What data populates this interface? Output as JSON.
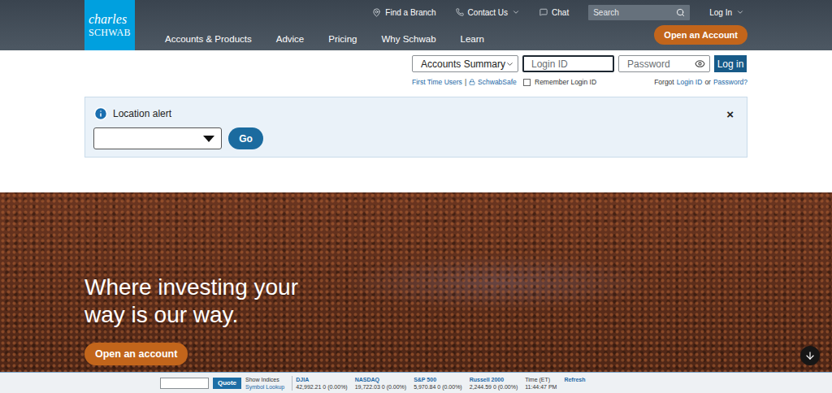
{
  "header": {
    "logo": {
      "line1": "charles",
      "line2": "SCHWAB"
    },
    "find_branch": "Find a Branch",
    "contact_us": "Contact Us",
    "chat": "Chat",
    "search": {
      "placeholder": "Search"
    },
    "login_menu": "Log In",
    "nav": [
      "Accounts & Products",
      "Advice",
      "Pricing",
      "Why Schwab",
      "Learn"
    ],
    "cta": "Open an Account"
  },
  "login": {
    "view_select": "Accounts Summary",
    "login_id": {
      "placeholder": "Login ID",
      "focused": true
    },
    "password": {
      "placeholder": "Password"
    },
    "button": "Log in",
    "first_time": "First Time Users",
    "separator": "|",
    "schwabsafe": "SchwabSafe",
    "remember": {
      "label": "Remember Login ID",
      "checked": false
    },
    "forgot": {
      "prefix": "Forgot",
      "login_id": "Login ID",
      "or": "or",
      "password": "Password?"
    }
  },
  "alert": {
    "title": "Location alert",
    "close": "×",
    "select_value": "",
    "button": "Go"
  },
  "hero": {
    "lines": [
      "Where investing your",
      "way is our way."
    ],
    "button": "Open an account"
  },
  "ticker": {
    "quote_button": "Quote",
    "show_indices": "Show Indices",
    "symbol_lookup": "Symbol Lookup",
    "indices": [
      {
        "name": "DJIA",
        "value": "42,992.21 0 (0.00%)"
      },
      {
        "name": "NASDAQ",
        "value": "19,722.03 0 (0.00%)"
      },
      {
        "name": "S&P 500",
        "value": "5,970.84 0 (0.00%)"
      },
      {
        "name": "Russell 2000",
        "value": "2,244.59 0 (0.00%)"
      }
    ],
    "time_label": "Time (ET)",
    "time": "11:44:47 PM",
    "refresh": "Refresh"
  }
}
